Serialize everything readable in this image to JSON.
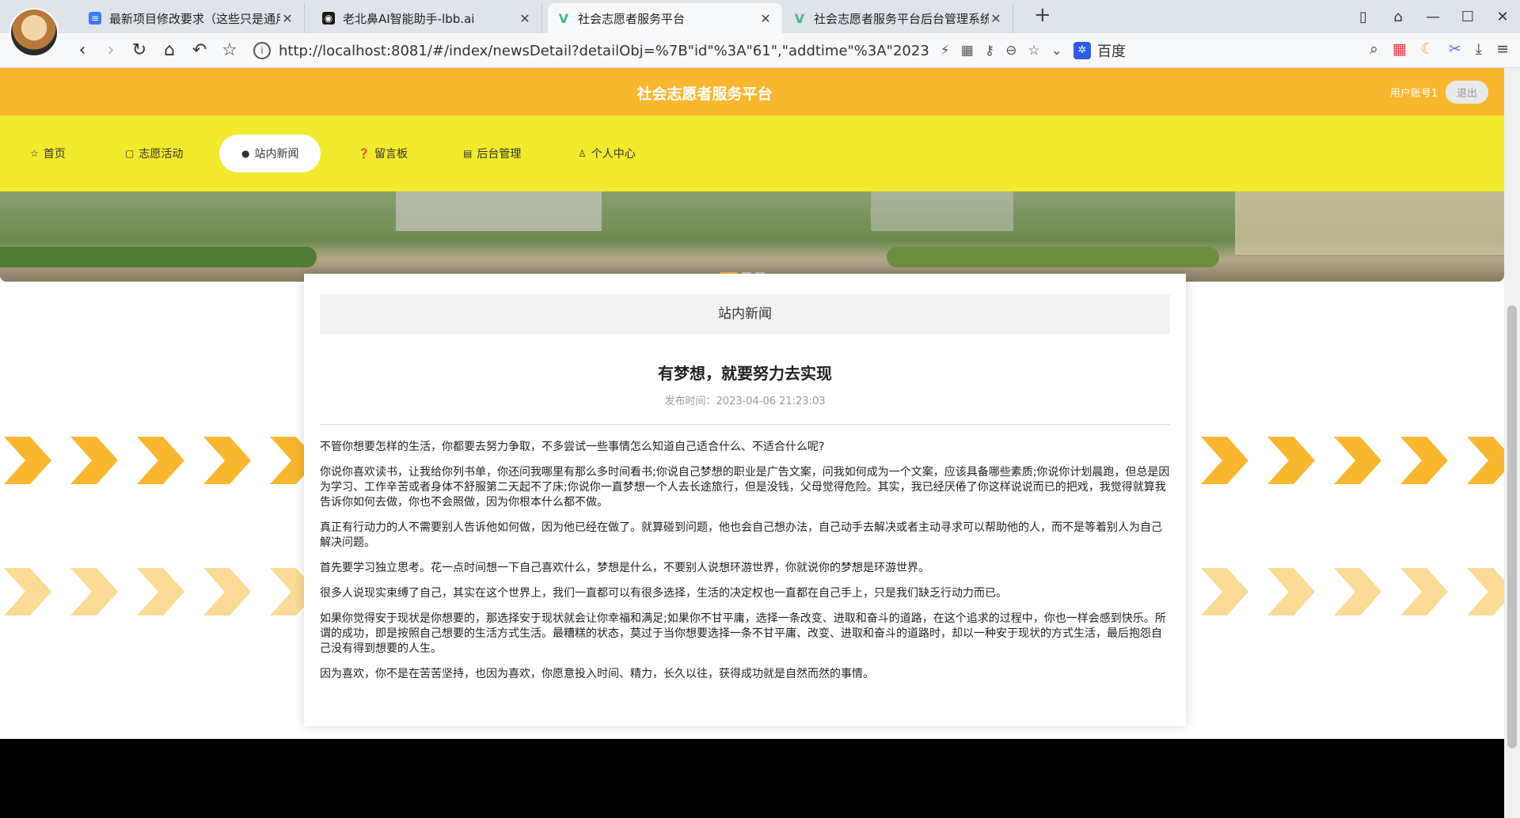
{
  "browser": {
    "tabs": [
      {
        "title": "最新项目修改要求（这些只是通用",
        "favicon": "doc-icon",
        "active": false
      },
      {
        "title": "老北鼻AI智能助手-lbb.ai",
        "favicon": "ai-icon",
        "active": false
      },
      {
        "title": "社会志愿者服务平台",
        "favicon": "vue-icon",
        "active": true
      },
      {
        "title": "社会志愿者服务平台后台管理系统",
        "favicon": "vue-icon",
        "active": false
      }
    ],
    "url": "http://localhost:8081/#/index/newsDetail?detailObj=%7B\"id\"%3A\"61\",\"addtime\"%3A\"2023-0...",
    "search_engine": "百度"
  },
  "site": {
    "title": "社会志愿者服务平台",
    "user_label": "用户账号1",
    "logout_label": "退出"
  },
  "nav": [
    {
      "label": "首页",
      "icon": "star-icon"
    },
    {
      "label": "志愿活动",
      "icon": "bag-icon"
    },
    {
      "label": "站内新闻",
      "icon": "info-icon",
      "active": true
    },
    {
      "label": "留言板",
      "icon": "question-icon"
    },
    {
      "label": "后台管理",
      "icon": "calendar-icon"
    },
    {
      "label": "个人中心",
      "icon": "user-icon"
    }
  ],
  "banner": {
    "slides": 3,
    "current_slide": 1
  },
  "section": {
    "heading": "站内新闻"
  },
  "article": {
    "title": "有梦想，就要努力去实现",
    "time": "发布时间：2023-04-06 21:23:03",
    "paragraphs": [
      "不管你想要怎样的生活，你都要去努力争取，不多尝试一些事情怎么知道自己适合什么、不适合什么呢?",
      "你说你喜欢读书，让我给你列书单，你还问我哪里有那么多时间看书;你说自己梦想的职业是广告文案，问我如何成为一个文案，应该具备哪些素质;你说你计划晨跑，但总是因为学习、工作辛苦或者身体不舒服第二天起不了床;你说你一直梦想一个人去长途旅行，但是没钱，父母觉得危险。其实，我已经厌倦了你这样说说而已的把戏，我觉得就算我告诉你如何去做，你也不会照做，因为你根本什么都不做。",
      "真正有行动力的人不需要别人告诉他如何做，因为他已经在做了。就算碰到问题，他也会自己想办法，自己动手去解决或者主动寻求可以帮助他的人，而不是等着别人为自己解决问题。",
      "首先要学习独立思考。花一点时间想一下自己喜欢什么，梦想是什么，不要别人说想环游世界，你就说你的梦想是环游世界。",
      "很多人说现实束缚了自己，其实在这个世界上，我们一直都可以有很多选择，生活的决定权也一直都在自己手上，只是我们缺乏行动力而已。",
      "如果你觉得安于现状是你想要的，那选择安于现状就会让你幸福和满足;如果你不甘平庸，选择一条改变、进取和奋斗的道路，在这个追求的过程中，你也一样会感到快乐。所谓的成功，即是按照自己想要的生活方式生活。最糟糕的状态，莫过于当你想要选择一条不甘平庸、改变、进取和奋斗的道路时，却以一种安于现状的方式生活，最后抱怨自己没有得到想要的人生。",
      "因为喜欢，你不是在苦苦坚持，也因为喜欢，你愿意投入时间、精力，长久以往，获得成功就是自然而然的事情。"
    ]
  },
  "colors": {
    "header": "#f9b730",
    "nav": "#f2ea2c",
    "chevron": "#f9b730",
    "chevron_light": "#fdebc9"
  }
}
